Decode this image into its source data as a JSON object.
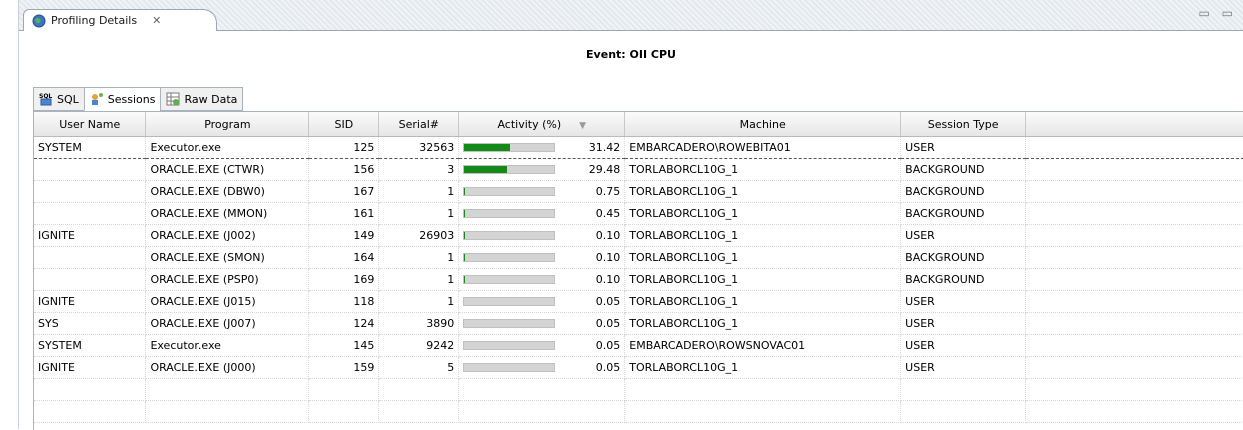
{
  "view": {
    "tab_title": "Profiling Details",
    "close_glyph": "✕",
    "corner_controls": "▭ ▭",
    "icon": "profiling-globe-icon"
  },
  "event": {
    "title": "Event: OII CPU"
  },
  "subtabs": [
    {
      "label": "SQL",
      "icon": "sql-icon",
      "active": false
    },
    {
      "label": "Sessions",
      "icon": "sessions-icon",
      "active": true
    },
    {
      "label": "Raw Data",
      "icon": "raw-data-icon",
      "active": false
    }
  ],
  "table": {
    "columns": [
      "User Name",
      "Program",
      "SID",
      "Serial#",
      "Activity (%)",
      "Machine",
      "Session Type"
    ],
    "sort_indicator": "▼",
    "rows": [
      {
        "user": "SYSTEM",
        "program": "Executor.exe",
        "sid": "125",
        "serial": "32563",
        "activity": 31.42,
        "activity_text": "31.42",
        "machine": "EMBARCADERO\\ROWEBITA01",
        "type": "USER",
        "selected": true
      },
      {
        "user": "",
        "program": "ORACLE.EXE (CTWR)",
        "sid": "156",
        "serial": "3",
        "activity": 29.48,
        "activity_text": "29.48",
        "machine": "TORLABORCL10G_1",
        "type": "BACKGROUND"
      },
      {
        "user": "",
        "program": "ORACLE.EXE (DBW0)",
        "sid": "167",
        "serial": "1",
        "activity": 0.75,
        "activity_text": "0.75",
        "machine": "TORLABORCL10G_1",
        "type": "BACKGROUND"
      },
      {
        "user": "",
        "program": "ORACLE.EXE (MMON)",
        "sid": "161",
        "serial": "1",
        "activity": 0.45,
        "activity_text": "0.45",
        "machine": "TORLABORCL10G_1",
        "type": "BACKGROUND"
      },
      {
        "user": "IGNITE",
        "program": "ORACLE.EXE (J002)",
        "sid": "149",
        "serial": "26903",
        "activity": 0.1,
        "activity_text": "0.10",
        "machine": "TORLABORCL10G_1",
        "type": "USER"
      },
      {
        "user": "",
        "program": "ORACLE.EXE (SMON)",
        "sid": "164",
        "serial": "1",
        "activity": 0.1,
        "activity_text": "0.10",
        "machine": "TORLABORCL10G_1",
        "type": "BACKGROUND"
      },
      {
        "user": "",
        "program": "ORACLE.EXE (PSP0)",
        "sid": "169",
        "serial": "1",
        "activity": 0.1,
        "activity_text": "0.10",
        "machine": "TORLABORCL10G_1",
        "type": "BACKGROUND"
      },
      {
        "user": "IGNITE",
        "program": "ORACLE.EXE (J015)",
        "sid": "118",
        "serial": "1",
        "activity": 0.05,
        "activity_text": "0.05",
        "machine": "TORLABORCL10G_1",
        "type": "USER"
      },
      {
        "user": "SYS",
        "program": "ORACLE.EXE (J007)",
        "sid": "124",
        "serial": "3890",
        "activity": 0.05,
        "activity_text": "0.05",
        "machine": "TORLABORCL10G_1",
        "type": "USER"
      },
      {
        "user": "SYSTEM",
        "program": "Executor.exe",
        "sid": "145",
        "serial": "9242",
        "activity": 0.05,
        "activity_text": "0.05",
        "machine": "EMBARCADERO\\ROWSNOVAC01",
        "type": "USER"
      },
      {
        "user": "IGNITE",
        "program": "ORACLE.EXE (J000)",
        "sid": "159",
        "serial": "5",
        "activity": 0.05,
        "activity_text": "0.05",
        "machine": "TORLABORCL10G_1",
        "type": "USER"
      }
    ],
    "empty_rows": 2
  },
  "colors": {
    "bar_fill": "#148a1a",
    "bar_track": "#d4d4d4"
  }
}
